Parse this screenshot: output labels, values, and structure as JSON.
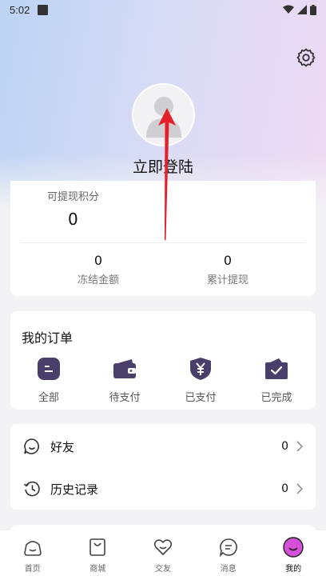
{
  "status_bar": {
    "time": "5:02"
  },
  "profile": {
    "login_label": "立即登陆"
  },
  "points": {
    "withdrawable_label": "可提现积分",
    "withdrawable_value": "0",
    "frozen_value": "0",
    "frozen_label": "冻结金额",
    "total_value": "0",
    "total_label": "累计提现"
  },
  "orders": {
    "title": "我的订单",
    "items": [
      {
        "label": "全部",
        "icon": "all-orders-icon"
      },
      {
        "label": "待支付",
        "icon": "wallet-icon"
      },
      {
        "label": "已支付",
        "icon": "yuan-shield-icon"
      },
      {
        "label": "已完成",
        "icon": "check-box-icon"
      }
    ]
  },
  "list": {
    "friends_label": "好友",
    "friends_count": "0",
    "history_label": "历史记录",
    "history_count": "0"
  },
  "tabs": [
    {
      "label": "首页",
      "icon": "home-icon"
    },
    {
      "label": "商城",
      "icon": "shop-bag-icon"
    },
    {
      "label": "交友",
      "icon": "heart-icon"
    },
    {
      "label": "消息",
      "icon": "chat-icon"
    },
    {
      "label": "我的",
      "icon": "smile-avatar-icon",
      "active": true
    }
  ],
  "colors": {
    "accent": "#4a3f6b",
    "tab_active": "#d64fd8",
    "annotation_arrow": "#e5202a"
  }
}
